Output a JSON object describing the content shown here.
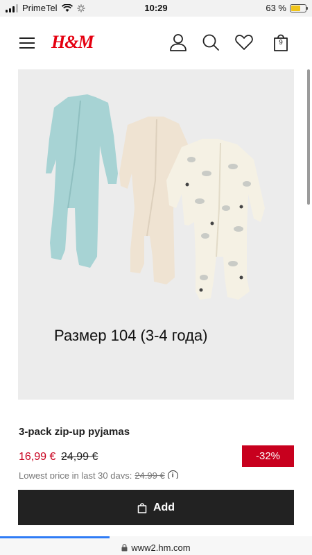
{
  "status_bar": {
    "carrier": "PrimeTel",
    "time": "10:29",
    "battery_percent_label": "63 %",
    "battery_level": 0.63,
    "battery_color": "#f0c419"
  },
  "header": {
    "logo": "H&M",
    "logo_color": "#e50010",
    "bag_count": "9",
    "icons": [
      "menu-icon",
      "account-icon",
      "search-icon",
      "heart-icon",
      "bag-icon"
    ]
  },
  "product": {
    "image_overlay_text": "Размер 104 (3-4 года)",
    "title": "3-pack zip-up pyjamas",
    "price_current": "16,99 €",
    "price_old": "24,99 €",
    "discount": "-32%",
    "lowest_price_label": "Lowest price in last 30 days:",
    "lowest_price_value": "24,99 €",
    "sale_color": "#c8001e"
  },
  "add_button": {
    "label": "Add",
    "icon": "bag-icon"
  },
  "browser": {
    "url": "www2.hm.com",
    "load_progress": 0.35,
    "accent_color": "#2f7cf6"
  }
}
